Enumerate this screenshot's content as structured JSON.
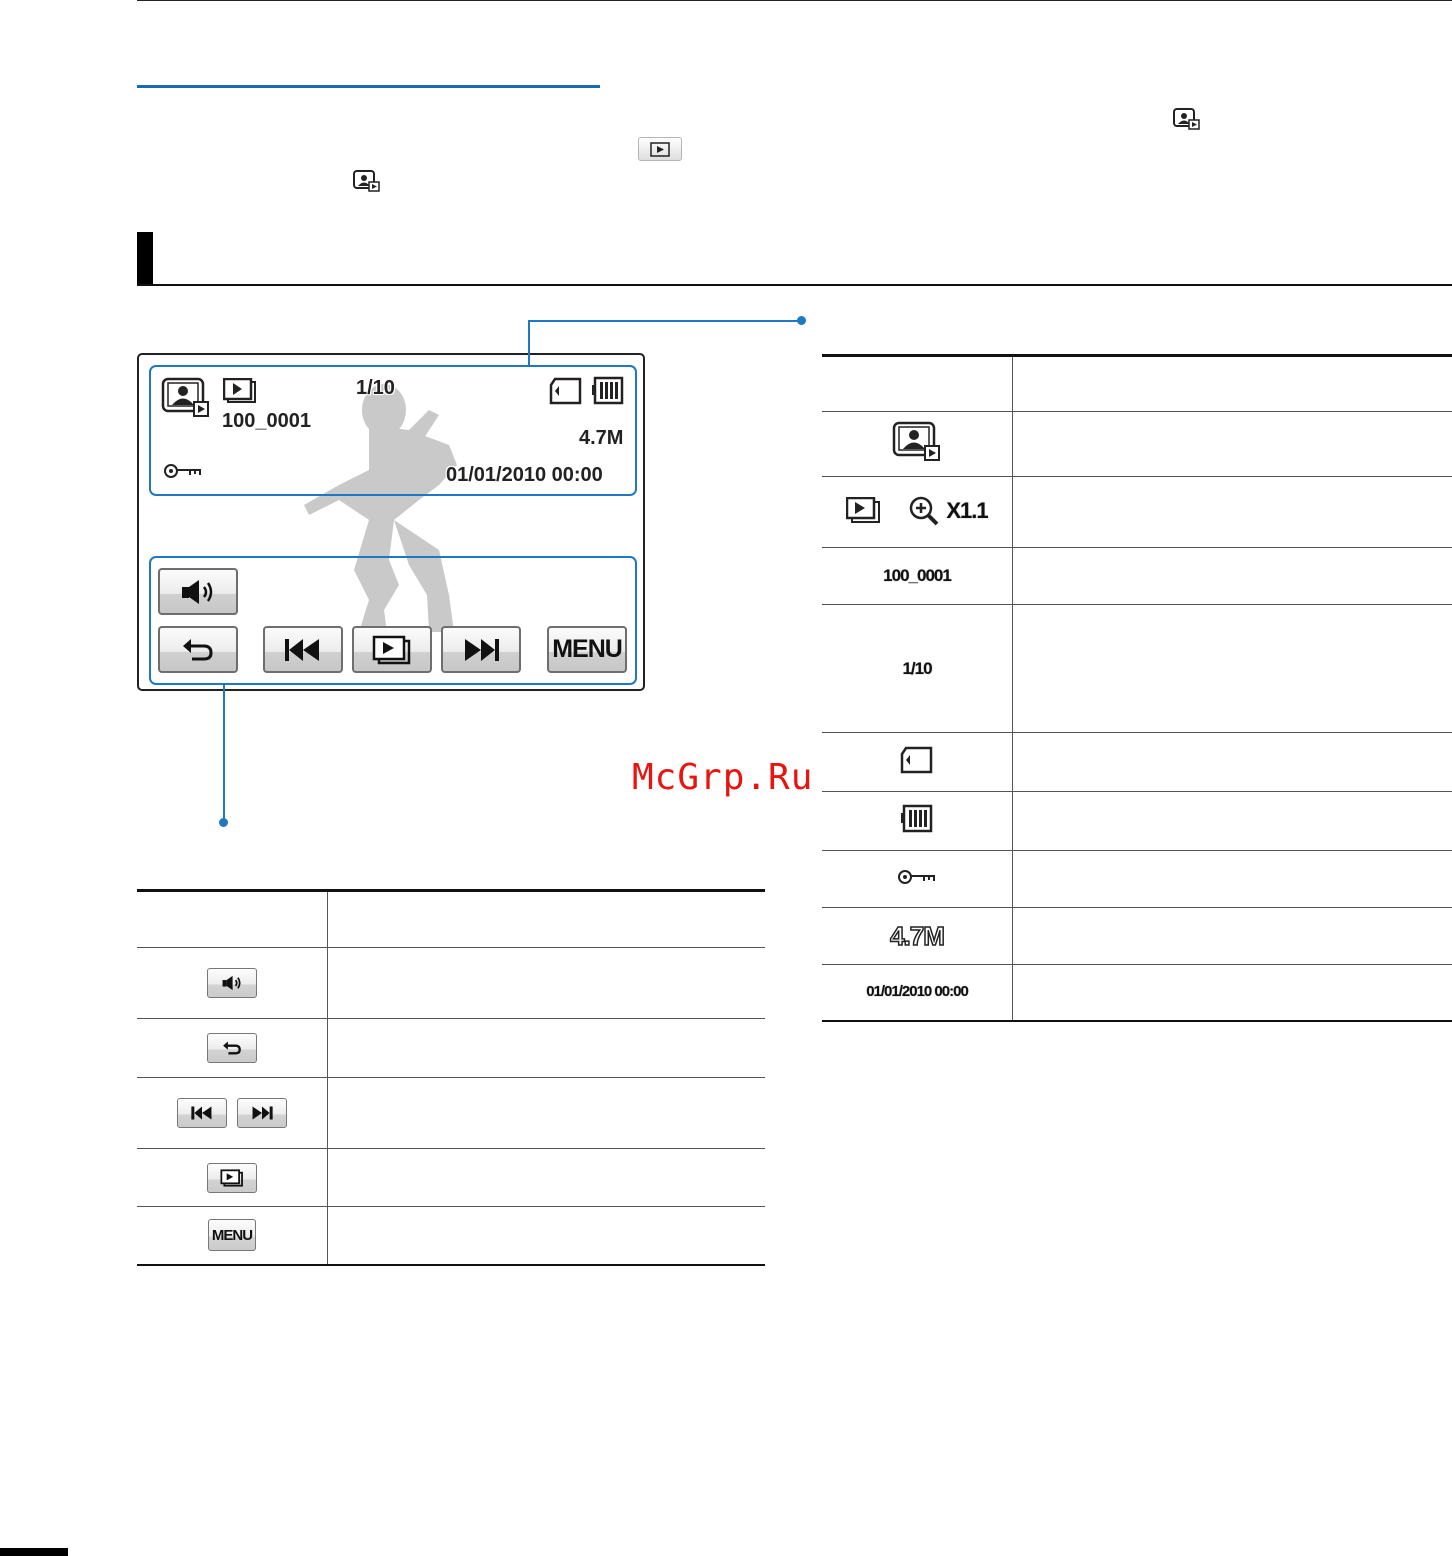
{
  "watermark": "McGrp.Ru",
  "lcd": {
    "counter": "1/10",
    "file_number": "100_0001",
    "file_size": "4.7M",
    "date_time": "01/01/2010 00:00",
    "menu_label": "MENU"
  },
  "right_table": {
    "rows": [
      {
        "icon": "photo-playback-mode-icon"
      },
      {
        "icon": "slide-show-icon",
        "zoom_label": "X1.1"
      },
      {
        "label": "100_0001"
      },
      {
        "label": "1/10"
      },
      {
        "icon": "memory-card-icon"
      },
      {
        "icon": "battery-icon"
      },
      {
        "icon": "protect-key-icon"
      },
      {
        "label": "4.7M"
      },
      {
        "label": "01/01/2010 00:00"
      }
    ]
  },
  "left_table": {
    "rows": [
      {
        "icon": "volume-button-icon"
      },
      {
        "icon": "return-button-icon"
      },
      {
        "icon": "prev-next-button-icon"
      },
      {
        "icon": "slide-show-button-icon"
      },
      {
        "label": "MENU"
      }
    ]
  }
}
